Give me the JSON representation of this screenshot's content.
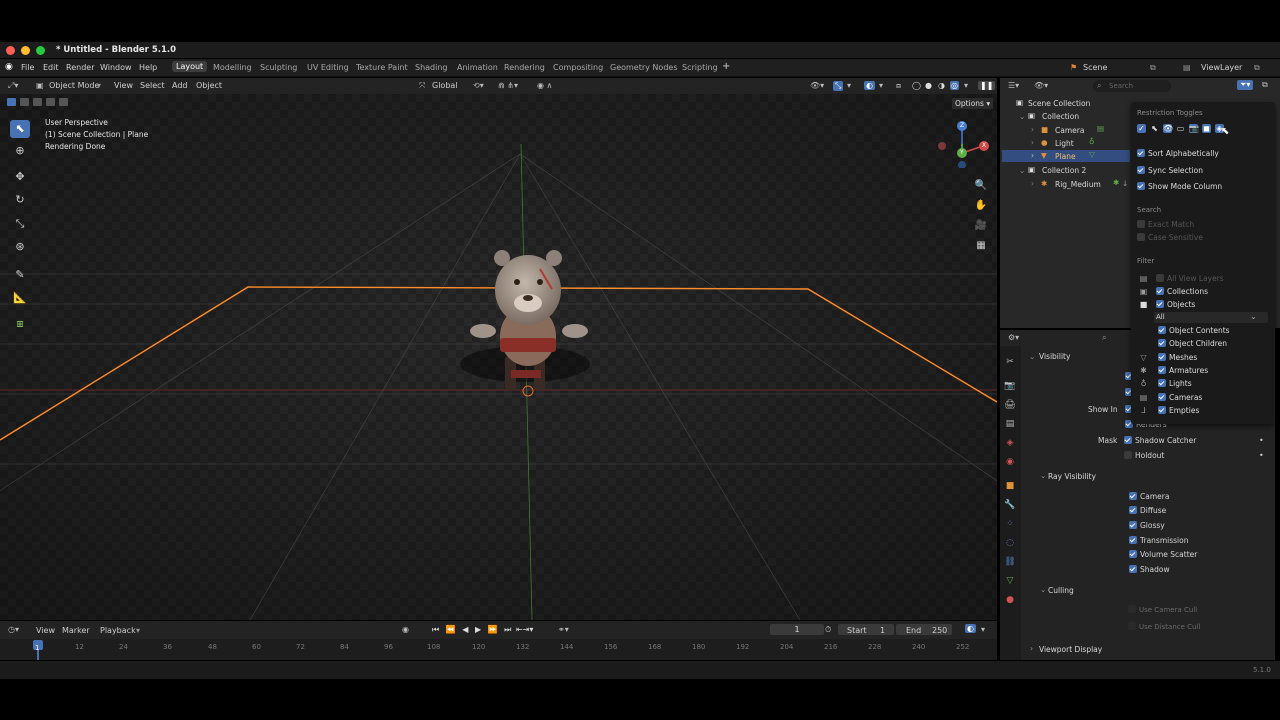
{
  "window": {
    "title": "* Untitled - Blender 5.1.0"
  },
  "menubar": {
    "menus": [
      "File",
      "Edit",
      "Render",
      "Window",
      "Help"
    ],
    "workspaces": [
      "Layout",
      "Modelling",
      "Sculpting",
      "UV Editing",
      "Texture Paint",
      "Shading",
      "Animation",
      "Rendering",
      "Compositing",
      "Geometry Nodes",
      "Scripting"
    ],
    "add_tab": "+",
    "scene": "Scene",
    "view_layer": "ViewLayer"
  },
  "viewport": {
    "mode": "Object Mode",
    "menus": [
      "View",
      "Select",
      "Add",
      "Object"
    ],
    "orientation": "Global",
    "options": "Options",
    "overlay_lines": [
      "User Perspective",
      "(1) Scene Collection | Plane",
      "Rendering Done"
    ],
    "gizmo": {
      "x": "X",
      "y": "Y",
      "z": "Z"
    }
  },
  "outliner": {
    "search_placeholder": "Search",
    "root": "Scene Collection",
    "items": [
      {
        "label": "Collection",
        "level": 1
      },
      {
        "label": "Camera",
        "level": 2
      },
      {
        "label": "Light",
        "level": 2
      },
      {
        "label": "Plane",
        "level": 2,
        "selected": true
      },
      {
        "label": "Collection 2",
        "level": 1
      },
      {
        "label": "Rig_Medium",
        "level": 2
      }
    ]
  },
  "filter_popup": {
    "restriction_header": "Restriction Toggles",
    "toggles": [
      {
        "label": "Sort Alphabetically",
        "checked": true
      },
      {
        "label": "Sync Selection",
        "checked": true
      },
      {
        "label": "Show Mode Column",
        "checked": true
      }
    ],
    "search_header": "Search",
    "search_options": [
      {
        "label": "Exact Match",
        "checked": false
      },
      {
        "label": "Case Sensitive",
        "checked": false
      }
    ],
    "filter_header": "Filter",
    "filters": [
      {
        "label": "All View Layers",
        "checked": false,
        "icon": "view-layers-icon"
      },
      {
        "label": "Collections",
        "checked": true,
        "icon": "collection-icon"
      },
      {
        "label": "Objects",
        "checked": true,
        "icon": "object-icon"
      }
    ],
    "objects_select": "All",
    "object_types": [
      {
        "label": "Object Contents",
        "checked": true,
        "icon": ""
      },
      {
        "label": "Object Children",
        "checked": true,
        "icon": ""
      },
      {
        "label": "Meshes",
        "checked": true,
        "icon": "mesh-icon"
      },
      {
        "label": "Armatures",
        "checked": true,
        "icon": "armature-icon"
      },
      {
        "label": "Lights",
        "checked": true,
        "icon": "light-icon"
      },
      {
        "label": "Cameras",
        "checked": true,
        "icon": "camera-icon"
      },
      {
        "label": "Empties",
        "checked": true,
        "icon": "empty-icon"
      }
    ]
  },
  "properties": {
    "visibility": "Visibility",
    "show_in": "Show In",
    "renders": "Renders",
    "mask": "Mask",
    "shadow_catcher": "Shadow Catcher",
    "holdout": "Holdout",
    "ray_visibility": "Ray Visibility",
    "rays": [
      "Camera",
      "Diffuse",
      "Glossy",
      "Transmission",
      "Volume Scatter",
      "Shadow"
    ],
    "culling": "Culling",
    "culling_options": [
      "Use Camera Cull",
      "Use Distance Cull"
    ],
    "viewport_display": "Viewport Display"
  },
  "timeline": {
    "menus": [
      "View",
      "Marker",
      "Playback"
    ],
    "current_frame": "1",
    "start_label": "Start",
    "start": "1",
    "end_label": "End",
    "end": "250",
    "ticks": [
      "1",
      "12",
      "24",
      "36",
      "48",
      "60",
      "72",
      "84",
      "96",
      "108",
      "120",
      "132",
      "144",
      "156",
      "168",
      "180",
      "192",
      "204",
      "216",
      "228",
      "240",
      "252"
    ]
  },
  "status": {
    "version": "5.1.0"
  },
  "colors": {
    "accent": "#4772b3",
    "selection": "#ff8c2a",
    "bg": "#393939"
  }
}
